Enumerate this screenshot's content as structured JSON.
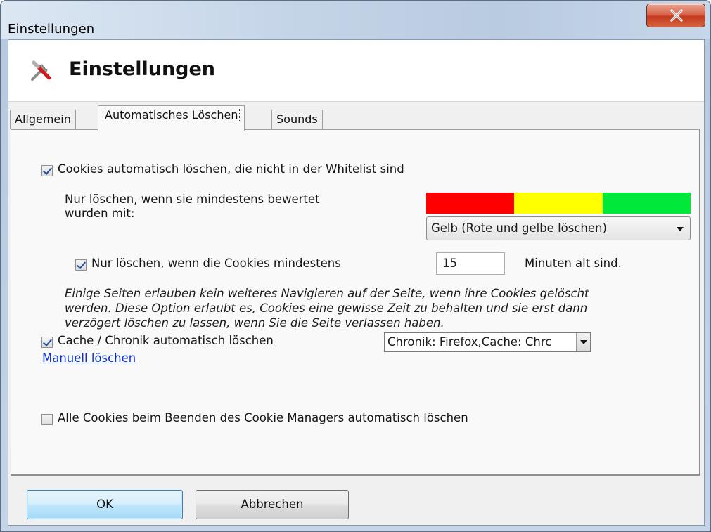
{
  "window": {
    "title": "Einstellungen",
    "close_glyph": "x"
  },
  "header": {
    "icon": "tools-icon",
    "title": "Einstellungen"
  },
  "tabs": [
    {
      "label": "Allgemein",
      "active": false
    },
    {
      "label": "Automatisches Löschen",
      "active": true
    },
    {
      "label": "Sounds",
      "active": false
    }
  ],
  "auto_delete": {
    "cookies_checkbox": {
      "label": "Cookies automatisch löschen, die nicht in der Whitelist sind",
      "checked": true
    },
    "rating_text_line1": "Nur löschen, wenn sie mindestens bewertet",
    "rating_text_line2": "wurden mit:",
    "rating_colors": [
      "#ff0000",
      "#ffff00",
      "#00e83a"
    ],
    "rating_select": {
      "value": "Gelb (Rote und gelbe löschen)"
    },
    "min_age_checkbox": {
      "label": "Nur löschen, wenn die Cookies mindestens",
      "checked": true
    },
    "min_age_value": "15",
    "min_age_unit": "Minuten alt sind.",
    "note_line1": "Einige Seiten erlauben kein weiteres Navigieren auf der Seite, wenn ihre Cookies gelöscht",
    "note_line2": "werden. Diese Option erlaubt es, Cookies eine gewisse Zeit zu behalten und sie erst dann",
    "note_line3": "verzögert löschen zu lassen, wenn Sie die Seite verlassen haben.",
    "cache_checkbox": {
      "label": "Cache / Chronik automatisch löschen",
      "checked": true
    },
    "cache_combo": {
      "value": "Chronik: Firefox,Cache: Chrc"
    },
    "manual_link": "Manuell löschen",
    "exit_checkbox": {
      "label": "Alle Cookies beim Beenden des Cookie Managers automatisch löschen",
      "checked": false
    }
  },
  "footer": {
    "ok_label": "OK",
    "cancel_label": "Abbrechen"
  }
}
